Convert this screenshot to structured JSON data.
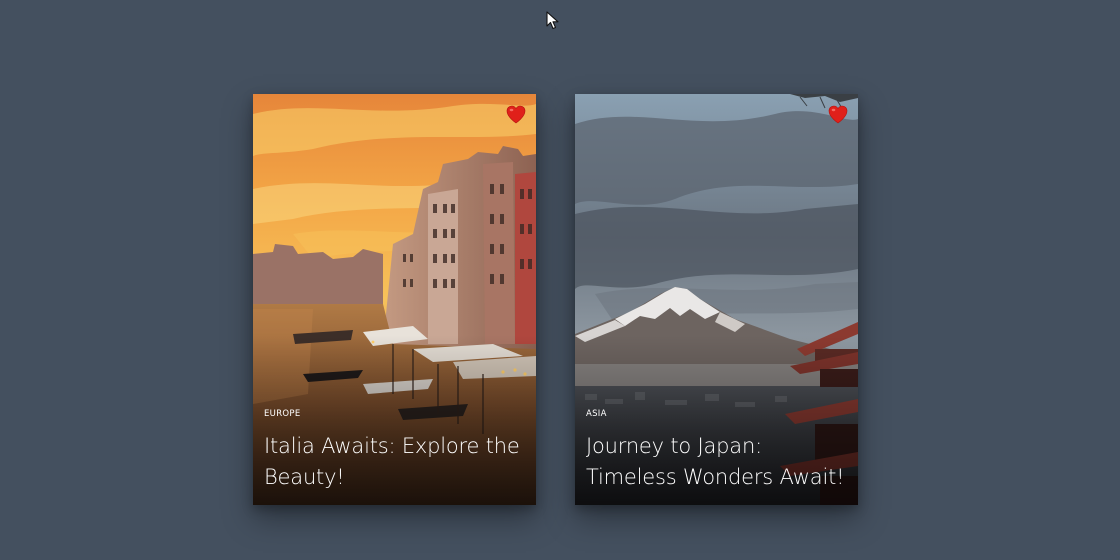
{
  "cards": [
    {
      "category": "EUROPE",
      "title": "Italia Awaits: Explore the Beauty!",
      "image_icon": "venice-canal-photo",
      "favorite_icon": "heart-icon",
      "favorite_color": "#e0201a"
    },
    {
      "category": "ASIA",
      "title": "Journey to Japan: Timeless Wonders Await!",
      "image_icon": "mount-fuji-photo",
      "favorite_icon": "heart-icon",
      "favorite_color": "#e0201a"
    }
  ],
  "colors": {
    "background": "#44505f",
    "text": "#ffffff"
  }
}
